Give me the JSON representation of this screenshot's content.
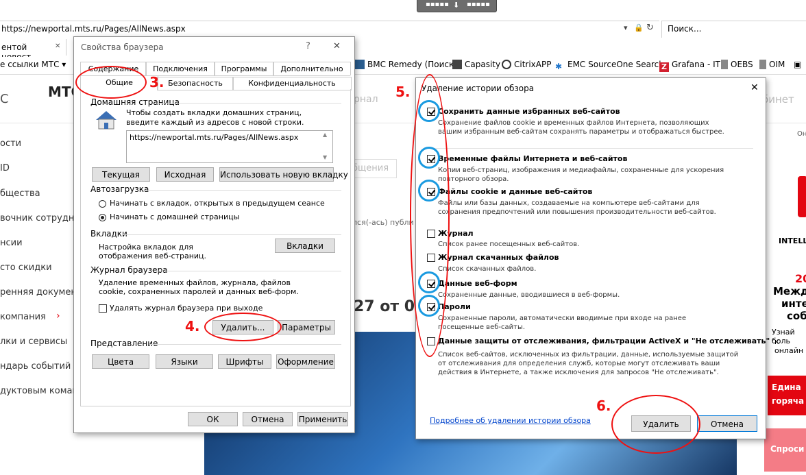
{
  "browser": {
    "address": "https://newportal.mts.ru/Pages/AllNews.aspx",
    "search_placeholder": "Поиск...",
    "tab_title": "ентой новост...",
    "favorites_label": "е ссылки МТС",
    "favorites": [
      "BMC Remedy (Поиск)",
      "Capasity",
      "CitrixAPP",
      "EMC SourceOne Search",
      "Grafana - IT",
      "OEBS",
      "OIM"
    ]
  },
  "page": {
    "logo_partial": "С",
    "brand_partial": "МТС",
    "nav_partial": "рнал",
    "cabinet_partial": "бинет",
    "right_top": "Он",
    "search_partial": "бщения",
    "author_partial": "лся(-ась) публи",
    "headline_partial": "27 от 06",
    "sidebar": [
      "ости",
      "ID",
      "бщества",
      "вочник сотрудн",
      "нсии",
      "сто скидки",
      "ренняя документ",
      "компания",
      "лки и сервисы",
      "ндарь событий",
      "дуктовым команд"
    ],
    "ad": {
      "brand": "INTELL",
      "year": "20",
      "l1": "Между",
      "l2": "инте",
      "l3": "соб",
      "l4": "Узнай боль",
      "l5": "к онлайн",
      "box1a": "Едина",
      "box1b": "горяча",
      "box2": "Спроси"
    }
  },
  "props_dialog": {
    "title": "Свойства браузера",
    "help": "?",
    "close": "✕",
    "tabs_back": [
      "Содержание",
      "Подключения",
      "Программы",
      "Дополнительно"
    ],
    "tabs_front": [
      "Общие",
      "Безопасность",
      "Конфиденциальность"
    ],
    "home_group": "Домашняя страница",
    "home_desc": "Чтобы создать вкладки домашних страниц, введите каждый из адресов с новой строки.",
    "home_url": "https://newportal.mts.ru/Pages/AllNews.aspx",
    "btn_current": "Текущая",
    "btn_default": "Исходная",
    "btn_newtab": "Использовать новую вкладку",
    "startup_group": "Автозагрузка",
    "startup_opt1": "Начинать с вкладок, открытых в предыдущем сеансе",
    "startup_opt2": "Начинать с домашней страницы",
    "tabs_group": "Вкладки",
    "tabs_desc": "Настройка вкладок для отображения веб-страниц.",
    "btn_tabs": "Вкладки",
    "history_group": "Журнал браузера",
    "history_desc": "Удаление временных файлов, журнала, файлов cookie, сохраненных паролей и данных веб-форм.",
    "history_checkbox": "Удалять журнал браузера при выходе",
    "btn_delete": "Удалить...",
    "btn_params": "Параметры",
    "appearance_group": "Представление",
    "btn_colors": "Цвета",
    "btn_langs": "Языки",
    "btn_fonts": "Шрифты",
    "btn_access": "Оформление",
    "btn_ok": "ОК",
    "btn_cancel": "Отмена",
    "btn_apply": "Применить"
  },
  "delete_dialog": {
    "title": "Удаление истории обзора",
    "close": "✕",
    "items": [
      {
        "title": "Сохранить данные избранных веб-сайтов",
        "desc": "Сохранение файлов cookie и временных файлов Интернета, позволяющих вашим избранным веб-сайтам сохранять параметры и отображаться быстрее.",
        "checked": true
      },
      {
        "title": "Временные файлы Интернета и веб-сайтов",
        "desc": "Копии веб-страниц, изображения и медиафайлы, сохраненные для ускорения повторного обзора.",
        "checked": true
      },
      {
        "title": "Файлы cookie и данные веб-сайтов",
        "desc": "Файлы или базы данных, создаваемые на компьютере веб-сайтами для сохранения предпочтений или повышения производительности веб-сайтов.",
        "checked": true
      },
      {
        "title": "Журнал",
        "desc": "Список ранее посещенных веб-сайтов.",
        "checked": false
      },
      {
        "title": "Журнал скачанных файлов",
        "desc": "Список скачанных файлов.",
        "checked": false
      },
      {
        "title": "Данные веб-форм",
        "desc": "Сохраненные данные, вводившиеся в веб-формы.",
        "checked": true
      },
      {
        "title": "Пароли",
        "desc": "Сохраненные пароли, автоматически вводимые при входе на ранее посещенные веб-сайты.",
        "checked": true
      },
      {
        "title": "Данные защиты от отслеживания, фильтрации ActiveX и \"Не отслеживать\"",
        "desc": "Список веб-сайтов, исключенных из фильтрации, данные, используемые защитой от отслеживания для определения служб, которые могут отслеживать ваши действия в Интернете, а также исключения для запросов \"Не отслеживать\".",
        "checked": false
      }
    ],
    "link": "Подробнее об удалении истории обзора",
    "btn_delete": "Удалить",
    "btn_cancel": "Отмена"
  },
  "annotations": {
    "n3": "3.",
    "n4": "4.",
    "n5": "5.",
    "n6": "6."
  },
  "colors": {
    "annotation_red": "#e11111",
    "annotation_blue": "#1a9ae0",
    "mts_red": "#e30611"
  }
}
